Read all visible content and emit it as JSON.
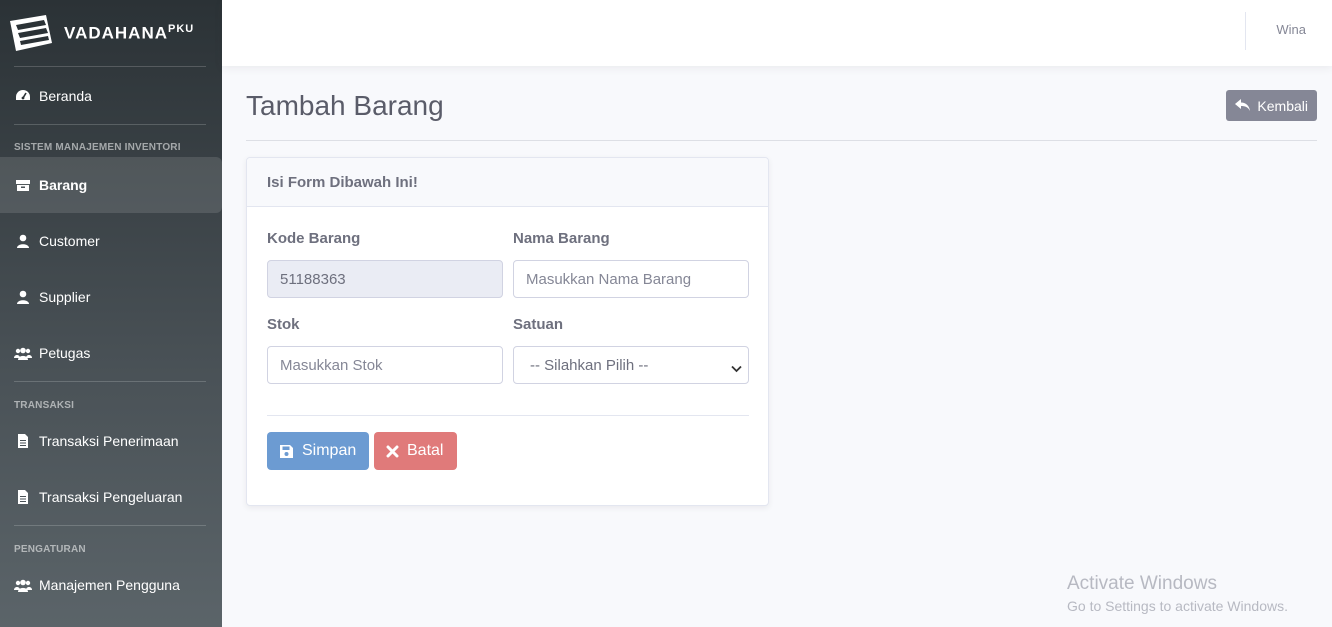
{
  "brand": {
    "name": "VADAHANA",
    "suffix": "PKU"
  },
  "sidebar": {
    "items": [
      {
        "label": "Beranda",
        "icon": "dashboard-icon"
      },
      {
        "heading": "SISTEM MANAJEMEN INVENTORI"
      },
      {
        "label": "Barang",
        "icon": "box-icon",
        "active": true
      },
      {
        "label": "Customer",
        "icon": "user-icon"
      },
      {
        "label": "Supplier",
        "icon": "user-icon"
      },
      {
        "label": "Petugas",
        "icon": "users-icon"
      },
      {
        "heading": "TRANSAKSI"
      },
      {
        "label": "Transaksi Penerimaan",
        "icon": "file-icon"
      },
      {
        "label": "Transaksi Pengeluaran",
        "icon": "file-icon"
      },
      {
        "heading": "PENGATURAN"
      },
      {
        "label": "Manajemen Pengguna",
        "icon": "users-icon"
      }
    ]
  },
  "topbar": {
    "user": "Wina"
  },
  "page": {
    "title": "Tambah Barang",
    "back_label": "Kembali"
  },
  "form": {
    "header": "Isi Form Dibawah Ini!",
    "kode_label": "Kode Barang",
    "kode_value": "51188363",
    "nama_label": "Nama Barang",
    "nama_placeholder": "Masukkan Nama Barang",
    "stok_label": "Stok",
    "stok_placeholder": "Masukkan Stok",
    "satuan_label": "Satuan",
    "satuan_selected": "-- Silahkan Pilih --",
    "save_label": "Simpan",
    "cancel_label": "Batal"
  },
  "watermark": {
    "line1": "Activate Windows",
    "line2": "Go to Settings to activate Windows."
  },
  "colors": {
    "sidebar_dark": "#2b3236",
    "save": "#6c9bd2",
    "cancel": "#e07a7a",
    "back": "#858796"
  }
}
